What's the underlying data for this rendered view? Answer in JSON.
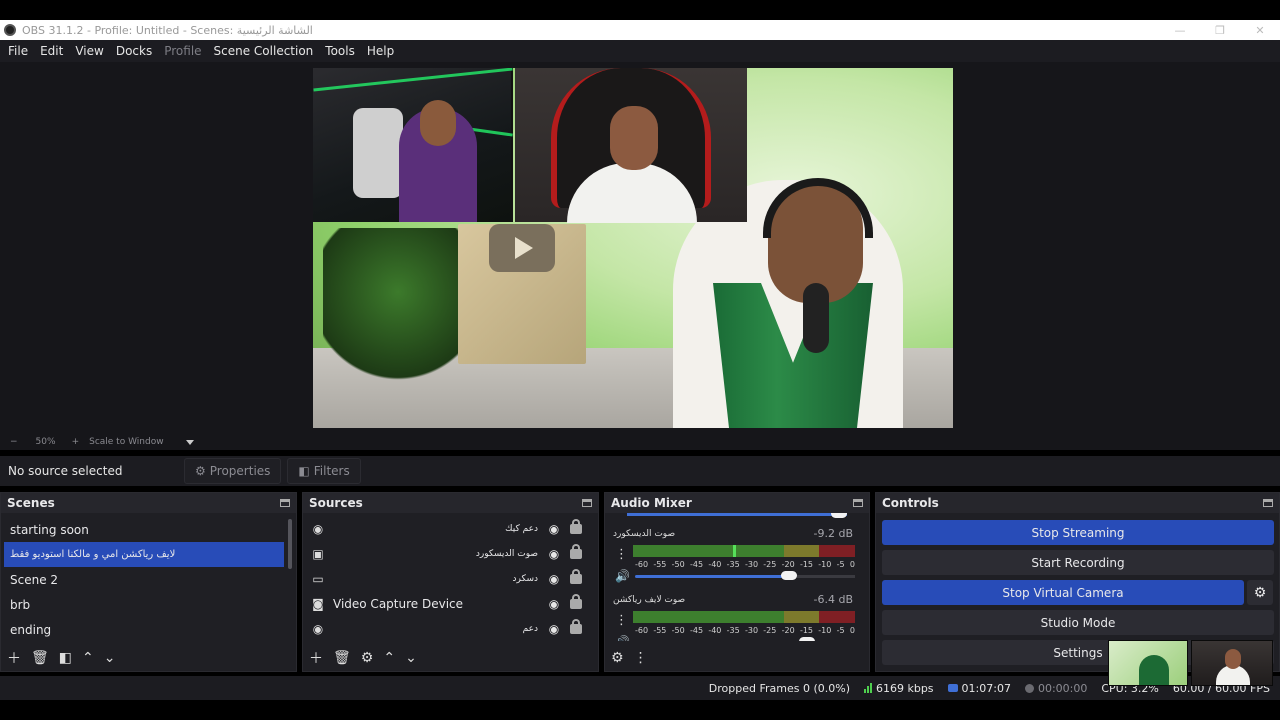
{
  "window": {
    "title": "OBS 31.1.2 - Profile: Untitled - Scenes: الشاشة الرئيسية"
  },
  "menu": [
    {
      "label": "File",
      "enabled": true
    },
    {
      "label": "Edit",
      "enabled": true
    },
    {
      "label": "View",
      "enabled": true
    },
    {
      "label": "Docks",
      "enabled": true
    },
    {
      "label": "Profile",
      "enabled": false
    },
    {
      "label": "Scene Collection",
      "enabled": true
    },
    {
      "label": "Tools",
      "enabled": true
    },
    {
      "label": "Help",
      "enabled": true
    }
  ],
  "zoom": {
    "minus": "−",
    "percent": "50%",
    "plus": "+",
    "mode": "Scale to Window"
  },
  "source_toolbar": {
    "status": "No source selected",
    "properties": "Properties",
    "filters": "Filters"
  },
  "scenes": {
    "title": "Scenes",
    "items": [
      {
        "label": "starting soon",
        "active": false
      },
      {
        "label": "لايف رياكشن امي و مالكنا  استوديو فقط",
        "active": true
      },
      {
        "label": "Scene 2",
        "active": false
      },
      {
        "label": "brb",
        "active": false
      },
      {
        "label": "ending",
        "active": false
      }
    ]
  },
  "sources": {
    "title": "Sources",
    "items": [
      {
        "label": "دعم كيك",
        "icon": "browser-icon",
        "rtl": true
      },
      {
        "label": "صوت الديسكورد",
        "icon": "audio-capture-icon",
        "rtl": true
      },
      {
        "label": "دسكرد",
        "icon": "window-capture-icon",
        "rtl": true
      },
      {
        "label": "Video Capture Device",
        "icon": "camera-icon",
        "rtl": false
      },
      {
        "label": "دعم",
        "icon": "browser-icon",
        "rtl": true
      }
    ]
  },
  "mixer": {
    "title": "Audio Mixer",
    "ticks": [
      "-60",
      "-55",
      "-50",
      "-45",
      "-40",
      "-35",
      "-30",
      "-25",
      "-20",
      "-15",
      "-10",
      "-5",
      "0"
    ],
    "channels": [
      {
        "name": "صوت الديسكورد",
        "db": "-9.2 dB",
        "level": 0.45,
        "volume": 0.7
      },
      {
        "name": "صوت لايف رياكشن",
        "db": "-6.4 dB",
        "level": 0.0,
        "volume": 0.78
      }
    ]
  },
  "controls": {
    "title": "Controls",
    "stop_streaming": "Stop Streaming",
    "start_recording": "Start Recording",
    "stop_virtual_camera": "Stop Virtual Camera",
    "studio_mode": "Studio Mode",
    "settings": "Settings"
  },
  "status": {
    "dropped_frames": "Dropped Frames 0 (0.0%)",
    "bitrate": "6169 kbps",
    "stream_time": "01:07:07",
    "record_time": "00:00:00",
    "cpu": "CPU: 3.2%",
    "fps": "60.00 / 60.00 FPS"
  },
  "colors": {
    "accent": "#284cb8",
    "panel": "#1f1f24",
    "meter_green": "#3d7f2e",
    "meter_yellow": "#7d7a2c",
    "meter_red": "#7f1f24"
  }
}
